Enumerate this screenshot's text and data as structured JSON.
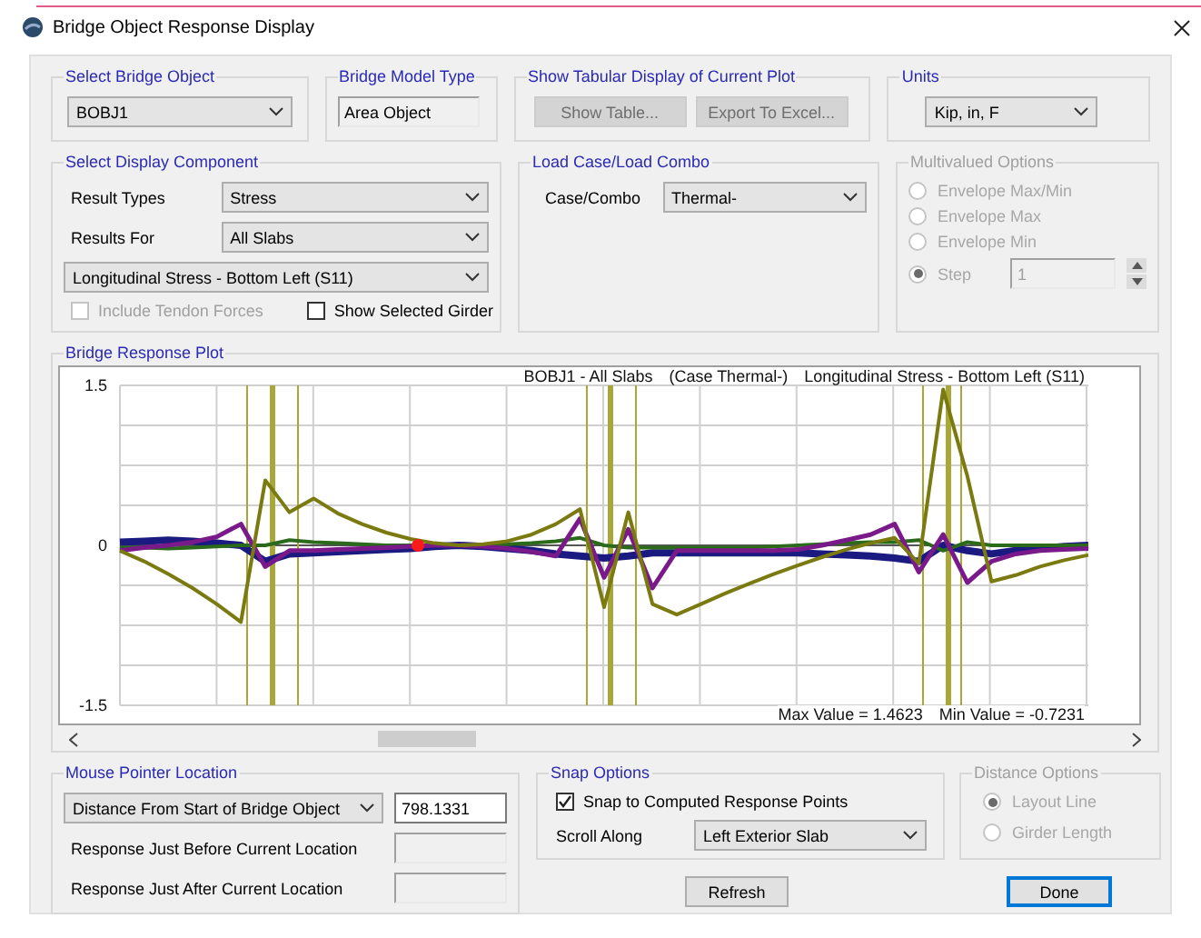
{
  "window": {
    "title": "Bridge Object Response Display"
  },
  "select_bridge_object": {
    "label": "Select Bridge Object",
    "value": "BOBJ1"
  },
  "bridge_model_type": {
    "label": "Bridge Model Type",
    "value": "Area Object"
  },
  "tabular_display": {
    "label": "Show Tabular Display of Current Plot",
    "buttons": [
      {
        "label": "Show Table...",
        "disabled": true
      },
      {
        "label": "Export To Excel...",
        "disabled": true
      }
    ]
  },
  "units": {
    "label": "Units",
    "value": "Kip, in, F"
  },
  "display_component": {
    "label": "Select Display Component",
    "result_types": {
      "label": "Result Types",
      "value": "Stress"
    },
    "results_for": {
      "label": "Results For",
      "value": "All Slabs"
    },
    "component": "Longitudinal Stress - Bottom Left (S11)",
    "checkboxes": [
      {
        "label": "Include Tendon Forces",
        "checked": false,
        "disabled": true
      },
      {
        "label": "Show Selected Girder",
        "checked": false,
        "disabled": false
      }
    ]
  },
  "load_case": {
    "label": "Load Case/Load Combo",
    "field_label": "Case/Combo",
    "value": "Thermal-"
  },
  "multivalued": {
    "label": "Multivalued Options",
    "disabled": true,
    "options": [
      {
        "label": "Envelope Max/Min",
        "selected": false
      },
      {
        "label": "Envelope Max",
        "selected": false
      },
      {
        "label": "Envelope Min",
        "selected": false
      },
      {
        "label": "Step",
        "selected": true
      }
    ],
    "step_value": "1"
  },
  "plot": {
    "label": "Bridge Response Plot",
    "title_parts": [
      "BOBJ1 - All Slabs",
      "(Case Thermal-)",
      "Longitudinal Stress - Bottom Left (S11)"
    ],
    "max_value": "Max Value = 1.4623",
    "min_value": "Min Value = -0.7231",
    "chart_data": {
      "type": "line",
      "categories": [
        null,
        null,
        null,
        null,
        null,
        null,
        null,
        null,
        null,
        null,
        null,
        null,
        null,
        null,
        null,
        null,
        null,
        null,
        null,
        null,
        null,
        null,
        null,
        null,
        null,
        null,
        null,
        null,
        null,
        null,
        null,
        null,
        null,
        null,
        null,
        null,
        null,
        null,
        null,
        null,
        null
      ],
      "ylim": [
        -1.5,
        1.5
      ],
      "yticks": [
        -1.5,
        0,
        1.5
      ],
      "grid": true,
      "series": [
        {
          "color": "#1a1a80",
          "values": [
            0.03,
            0.04,
            0.05,
            0.04,
            0.02,
            0.0,
            -0.15,
            -0.08,
            -0.07,
            -0.06,
            -0.05,
            -0.04,
            -0.03,
            -0.01,
            0.0,
            -0.01,
            -0.03,
            -0.05,
            -0.08,
            -0.1,
            -0.12,
            -0.1,
            -0.07,
            -0.07,
            -0.07,
            -0.07,
            -0.07,
            -0.07,
            -0.07,
            -0.08,
            -0.09,
            -0.1,
            -0.12,
            -0.15,
            0.0,
            -0.05,
            -0.08,
            -0.05,
            -0.03,
            -0.01,
            0.0
          ]
        },
        {
          "color": "#2a6a1a",
          "values": [
            -0.02,
            -0.02,
            -0.03,
            -0.02,
            -0.01,
            0.0,
            0.0,
            0.05,
            0.03,
            0.02,
            0.01,
            0.0,
            0.0,
            0.0,
            0.0,
            0.0,
            0.01,
            0.02,
            0.04,
            0.07,
            0.0,
            -0.02,
            -0.02,
            -0.02,
            -0.02,
            -0.02,
            -0.02,
            -0.01,
            0.0,
            0.01,
            0.02,
            0.03,
            0.03,
            0.05,
            -0.05,
            0.03,
            0.0,
            0.0,
            0.0,
            0.0,
            0.0
          ]
        },
        {
          "color": "#7a1a8a",
          "values": [
            -0.05,
            -0.02,
            0.0,
            0.03,
            0.08,
            0.2,
            -0.2,
            -0.05,
            -0.05,
            -0.04,
            -0.03,
            -0.02,
            -0.01,
            0.0,
            0.0,
            -0.01,
            -0.03,
            -0.06,
            -0.1,
            0.25,
            -0.3,
            0.15,
            -0.4,
            -0.05,
            -0.05,
            -0.05,
            -0.05,
            -0.05,
            -0.04,
            0.0,
            0.05,
            0.1,
            0.2,
            -0.25,
            0.1,
            -0.35,
            -0.15,
            -0.08,
            -0.05,
            -0.04,
            -0.03
          ]
        },
        {
          "color": "#7a7a10",
          "values": [
            -0.05,
            -0.15,
            -0.27,
            -0.4,
            -0.55,
            -0.72,
            0.61,
            0.31,
            0.44,
            0.3,
            0.2,
            0.12,
            0.06,
            0.02,
            0.0,
            0.01,
            0.04,
            0.1,
            0.2,
            0.34,
            -0.58,
            0.31,
            -0.55,
            -0.65,
            -0.55,
            -0.45,
            -0.36,
            -0.27,
            -0.19,
            -0.11,
            -0.04,
            0.02,
            0.07,
            -0.17,
            1.46,
            0.65,
            -0.34,
            -0.28,
            -0.2,
            -0.14,
            -0.09
          ]
        }
      ]
    }
  },
  "mouse_pointer": {
    "label": "Mouse Pointer Location",
    "mode": "Distance From Start of Bridge Object",
    "distance": "798.1331",
    "rows": [
      "Response Just Before Current Location",
      "Response Just After Current Location"
    ]
  },
  "snap": {
    "label": "Snap Options",
    "checkbox": {
      "label": "Snap to Computed Response Points",
      "checked": true
    },
    "scroll_along": {
      "label": "Scroll Along",
      "value": "Left Exterior Slab"
    }
  },
  "distance_options": {
    "label": "Distance Options",
    "disabled": true,
    "options": [
      {
        "label": "Layout Line",
        "selected": true
      },
      {
        "label": "Girder Length",
        "selected": false
      }
    ]
  },
  "buttons": [
    {
      "label": "Refresh",
      "default": false
    },
    {
      "label": "Done",
      "default": true
    }
  ]
}
